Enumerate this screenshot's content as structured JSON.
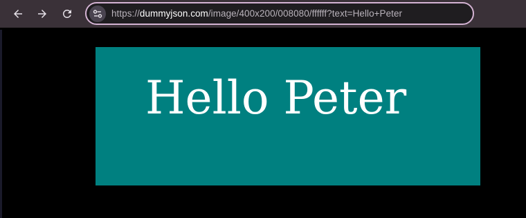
{
  "toolbar": {
    "back_icon": "arrow-left-icon",
    "forward_icon": "arrow-right-icon",
    "reload_icon": "reload-icon",
    "site_info_icon": "tune-icon"
  },
  "address_bar": {
    "scheme": "https://",
    "domain": "dummyjson.com",
    "path": "/image/400x200/008080/ffffff?text=Hello+Peter"
  },
  "image": {
    "background_color": "#008080",
    "text_color": "#ffffff",
    "text": "Hello Peter"
  }
}
